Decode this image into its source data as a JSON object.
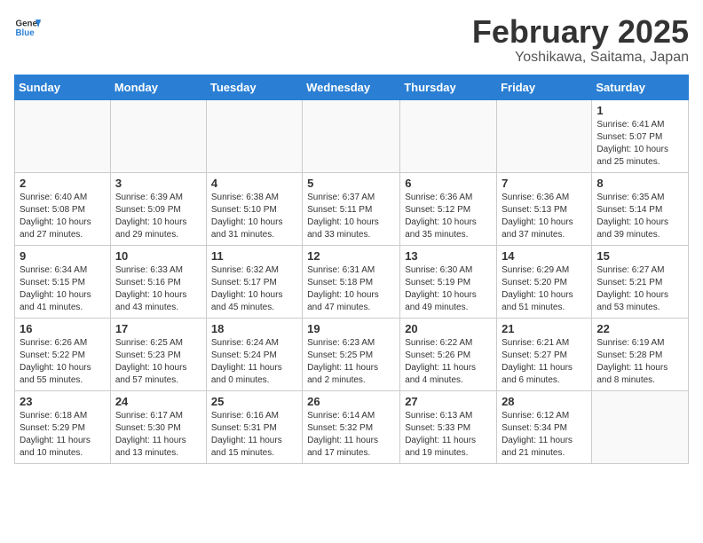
{
  "header": {
    "logo_line1": "General",
    "logo_line2": "Blue",
    "title": "February 2025",
    "subtitle": "Yoshikawa, Saitama, Japan"
  },
  "weekdays": [
    "Sunday",
    "Monday",
    "Tuesday",
    "Wednesday",
    "Thursday",
    "Friday",
    "Saturday"
  ],
  "weeks": [
    [
      {
        "day": "",
        "info": ""
      },
      {
        "day": "",
        "info": ""
      },
      {
        "day": "",
        "info": ""
      },
      {
        "day": "",
        "info": ""
      },
      {
        "day": "",
        "info": ""
      },
      {
        "day": "",
        "info": ""
      },
      {
        "day": "1",
        "info": "Sunrise: 6:41 AM\nSunset: 5:07 PM\nDaylight: 10 hours and 25 minutes."
      }
    ],
    [
      {
        "day": "2",
        "info": "Sunrise: 6:40 AM\nSunset: 5:08 PM\nDaylight: 10 hours and 27 minutes."
      },
      {
        "day": "3",
        "info": "Sunrise: 6:39 AM\nSunset: 5:09 PM\nDaylight: 10 hours and 29 minutes."
      },
      {
        "day": "4",
        "info": "Sunrise: 6:38 AM\nSunset: 5:10 PM\nDaylight: 10 hours and 31 minutes."
      },
      {
        "day": "5",
        "info": "Sunrise: 6:37 AM\nSunset: 5:11 PM\nDaylight: 10 hours and 33 minutes."
      },
      {
        "day": "6",
        "info": "Sunrise: 6:36 AM\nSunset: 5:12 PM\nDaylight: 10 hours and 35 minutes."
      },
      {
        "day": "7",
        "info": "Sunrise: 6:36 AM\nSunset: 5:13 PM\nDaylight: 10 hours and 37 minutes."
      },
      {
        "day": "8",
        "info": "Sunrise: 6:35 AM\nSunset: 5:14 PM\nDaylight: 10 hours and 39 minutes."
      }
    ],
    [
      {
        "day": "9",
        "info": "Sunrise: 6:34 AM\nSunset: 5:15 PM\nDaylight: 10 hours and 41 minutes."
      },
      {
        "day": "10",
        "info": "Sunrise: 6:33 AM\nSunset: 5:16 PM\nDaylight: 10 hours and 43 minutes."
      },
      {
        "day": "11",
        "info": "Sunrise: 6:32 AM\nSunset: 5:17 PM\nDaylight: 10 hours and 45 minutes."
      },
      {
        "day": "12",
        "info": "Sunrise: 6:31 AM\nSunset: 5:18 PM\nDaylight: 10 hours and 47 minutes."
      },
      {
        "day": "13",
        "info": "Sunrise: 6:30 AM\nSunset: 5:19 PM\nDaylight: 10 hours and 49 minutes."
      },
      {
        "day": "14",
        "info": "Sunrise: 6:29 AM\nSunset: 5:20 PM\nDaylight: 10 hours and 51 minutes."
      },
      {
        "day": "15",
        "info": "Sunrise: 6:27 AM\nSunset: 5:21 PM\nDaylight: 10 hours and 53 minutes."
      }
    ],
    [
      {
        "day": "16",
        "info": "Sunrise: 6:26 AM\nSunset: 5:22 PM\nDaylight: 10 hours and 55 minutes."
      },
      {
        "day": "17",
        "info": "Sunrise: 6:25 AM\nSunset: 5:23 PM\nDaylight: 10 hours and 57 minutes."
      },
      {
        "day": "18",
        "info": "Sunrise: 6:24 AM\nSunset: 5:24 PM\nDaylight: 11 hours and 0 minutes."
      },
      {
        "day": "19",
        "info": "Sunrise: 6:23 AM\nSunset: 5:25 PM\nDaylight: 11 hours and 2 minutes."
      },
      {
        "day": "20",
        "info": "Sunrise: 6:22 AM\nSunset: 5:26 PM\nDaylight: 11 hours and 4 minutes."
      },
      {
        "day": "21",
        "info": "Sunrise: 6:21 AM\nSunset: 5:27 PM\nDaylight: 11 hours and 6 minutes."
      },
      {
        "day": "22",
        "info": "Sunrise: 6:19 AM\nSunset: 5:28 PM\nDaylight: 11 hours and 8 minutes."
      }
    ],
    [
      {
        "day": "23",
        "info": "Sunrise: 6:18 AM\nSunset: 5:29 PM\nDaylight: 11 hours and 10 minutes."
      },
      {
        "day": "24",
        "info": "Sunrise: 6:17 AM\nSunset: 5:30 PM\nDaylight: 11 hours and 13 minutes."
      },
      {
        "day": "25",
        "info": "Sunrise: 6:16 AM\nSunset: 5:31 PM\nDaylight: 11 hours and 15 minutes."
      },
      {
        "day": "26",
        "info": "Sunrise: 6:14 AM\nSunset: 5:32 PM\nDaylight: 11 hours and 17 minutes."
      },
      {
        "day": "27",
        "info": "Sunrise: 6:13 AM\nSunset: 5:33 PM\nDaylight: 11 hours and 19 minutes."
      },
      {
        "day": "28",
        "info": "Sunrise: 6:12 AM\nSunset: 5:34 PM\nDaylight: 11 hours and 21 minutes."
      },
      {
        "day": "",
        "info": ""
      }
    ]
  ]
}
